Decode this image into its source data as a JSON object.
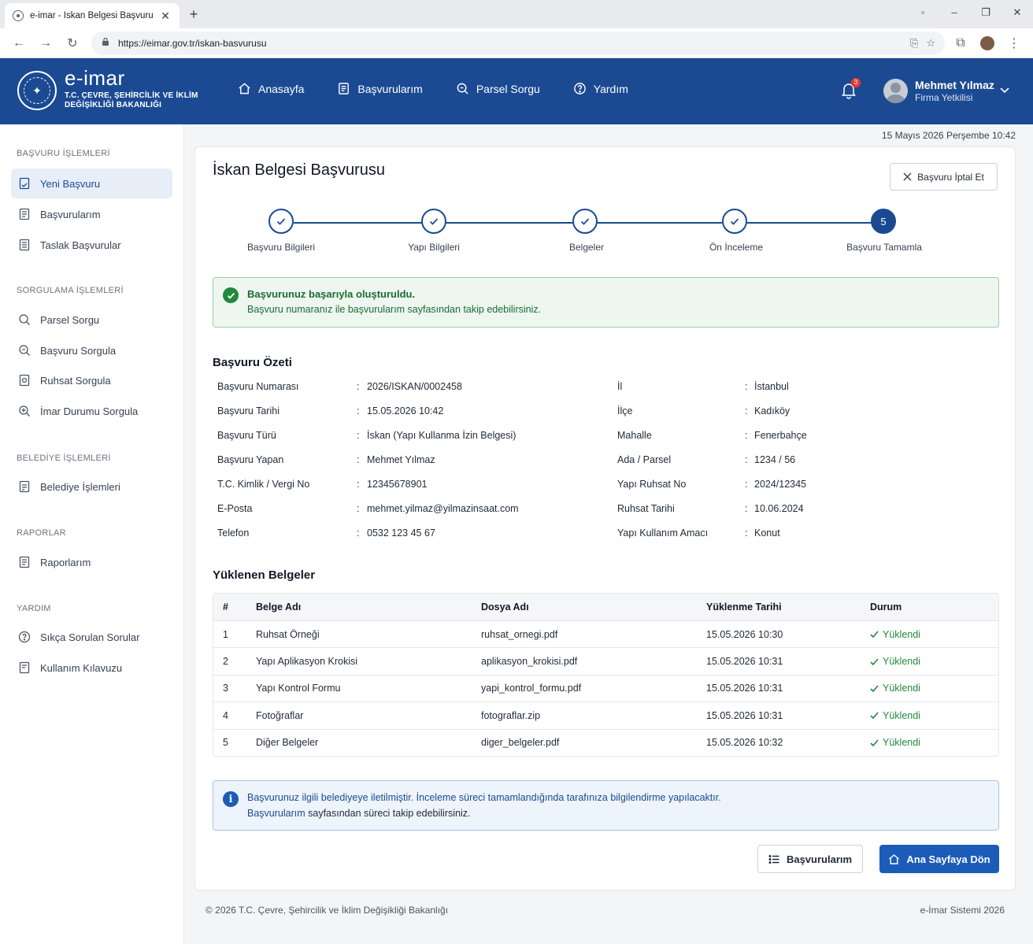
{
  "browser": {
    "tab_title": "e-imar - İskan Belgesi Başvurusu",
    "url": "https://eimar.gov.tr/iskan-basvurusu"
  },
  "header": {
    "brand_title": "e-imar",
    "brand_sub": "T.C. ÇEVRE, ŞEHİRCİLİK VE İKLİM DEĞİŞİKLİĞİ BAKANLIĞI",
    "nav": [
      "Anasayfa",
      "Başvurularım",
      "Parsel Sorgu",
      "Yardım"
    ],
    "notification_count": "3",
    "user_name": "Mehmet Yılmaz",
    "user_role": "Firma Yetkilisi"
  },
  "sidebar": {
    "sections": [
      {
        "title": "BAŞVURU İŞLEMLERİ",
        "items": [
          "Yeni Başvuru",
          "Başvurularım",
          "Taslak Başvurular"
        ]
      },
      {
        "title": "SORGULAMA İŞLEMLERİ",
        "items": [
          "Parsel Sorgu",
          "Başvuru Sorgula",
          "Ruhsat Sorgula",
          "İmar Durumu Sorgula"
        ]
      },
      {
        "title": "BELEDİYE İŞLEMLERİ",
        "items": [
          "Belediye İşlemleri"
        ]
      },
      {
        "title": "RAPORLAR",
        "items": [
          "Raporlarım"
        ]
      },
      {
        "title": "YARDIM",
        "items": [
          "Sıkça Sorulan Sorular",
          "Kullanım Kılavuzu"
        ]
      }
    ]
  },
  "datetime": "15 Mayıs 2026 Perşembe  10:42",
  "page": {
    "title": "İskan Belgesi Başvurusu",
    "cancel_label": "Başvuru İptal Et",
    "steps": [
      "Başvuru Bilgileri",
      "Yapı Bilgileri",
      "Belgeler",
      "Ön İnceleme",
      "Başvuru Tamamla"
    ],
    "current_step_number": "5",
    "success_title": "Başvurunuz başarıyla oluşturuldu.",
    "success_text": "Başvuru numaranız ile başvurularım sayfasından takip edebilirsiniz.",
    "summary_title": "Başvuru Özeti",
    "summary_left": [
      {
        "label": "Başvuru Numarası",
        "value": "2026/ISKAN/0002458"
      },
      {
        "label": "Başvuru Tarihi",
        "value": "15.05.2026 10:42"
      },
      {
        "label": "Başvuru Türü",
        "value": "İskan (Yapı Kullanma İzin Belgesi)"
      },
      {
        "label": "Başvuru Yapan",
        "value": "Mehmet Yılmaz"
      },
      {
        "label": "T.C. Kimlik / Vergi No",
        "value": "12345678901"
      },
      {
        "label": "E-Posta",
        "value": "mehmet.yilmaz@yilmazinsaat.com"
      },
      {
        "label": "Telefon",
        "value": "0532 123 45 67"
      }
    ],
    "summary_right": [
      {
        "label": "İl",
        "value": "İstanbul"
      },
      {
        "label": "İlçe",
        "value": "Kadıköy"
      },
      {
        "label": "Mahalle",
        "value": "Fenerbahçe"
      },
      {
        "label": "Ada / Parsel",
        "value": "1234 / 56"
      },
      {
        "label": "Yapı Ruhsat No",
        "value": "2024/12345"
      },
      {
        "label": "Ruhsat Tarihi",
        "value": "10.06.2024"
      },
      {
        "label": "Yapı Kullanım Amacı",
        "value": "Konut"
      }
    ],
    "docs_title": "Yüklenen Belgeler",
    "docs_headers": [
      "#",
      "Belge Adı",
      "Dosya Adı",
      "Yüklenme Tarihi",
      "Durum"
    ],
    "docs_rows": [
      {
        "num": "1",
        "name": "Ruhsat Örneği",
        "file": "ruhsat_ornegi.pdf",
        "date": "15.05.2026 10:30",
        "status": "Yüklendi"
      },
      {
        "num": "2",
        "name": "Yapı Aplikasyon Krokisi",
        "file": "aplikasyon_krokisi.pdf",
        "date": "15.05.2026 10:31",
        "status": "Yüklendi"
      },
      {
        "num": "3",
        "name": "Yapı Kontrol Formu",
        "file": "yapi_kontrol_formu.pdf",
        "date": "15.05.2026 10:31",
        "status": "Yüklendi"
      },
      {
        "num": "4",
        "name": "Fotoğraflar",
        "file": "fotograflar.zip",
        "date": "15.05.2026 10:31",
        "status": "Yüklendi"
      },
      {
        "num": "5",
        "name": "Diğer Belgeler",
        "file": "diger_belgeler.pdf",
        "date": "15.05.2026 10:32",
        "status": "Yüklendi"
      }
    ],
    "info_line1": "Başvurunuz ilgili belediyeye iletilmiştir. İnceleme süreci tamamlandığında tarafınıza bilgilendirme yapılacaktır.",
    "info_link": "Başvurularım",
    "info_line2_rest": " sayfasından süreci takip edebilirsiniz.",
    "btn_applications": "Başvurularım",
    "btn_home": "Ana Sayfaya Dön"
  },
  "footer": {
    "left": "© 2026 T.C. Çevre, Şehircilik ve İklim Değişikliği Bakanlığı",
    "right": "e-İmar Sistemi 2026"
  },
  "colors": {
    "primary": "#1b4a93",
    "success": "#21883d",
    "info": "#1b5cb8"
  }
}
